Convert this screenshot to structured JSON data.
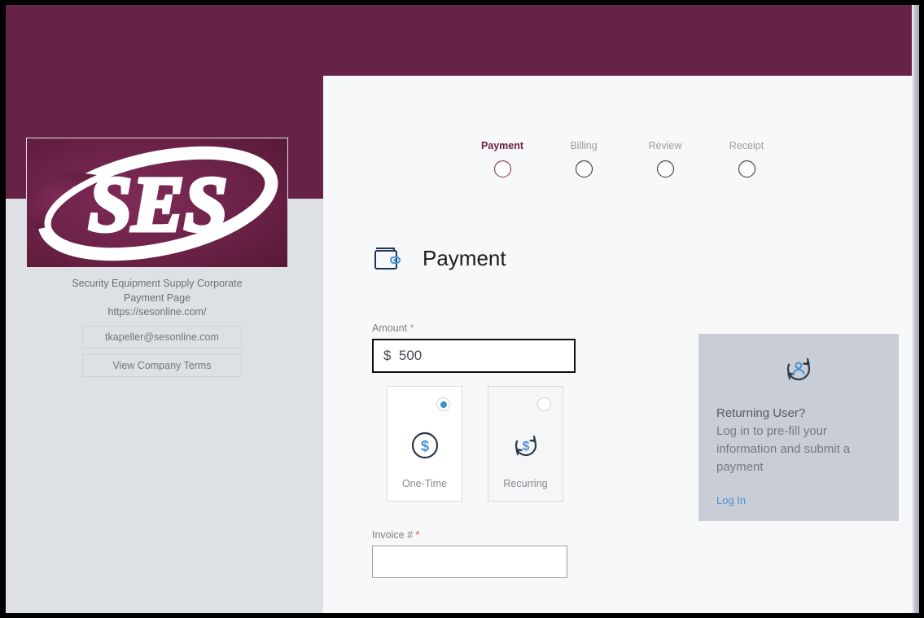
{
  "sidebar": {
    "logo_text": "SES",
    "description_line1": "Security Equipment Supply Corporate",
    "description_line2": "Payment Page",
    "url": "https://sesonline.com/",
    "email_button": "tkapeller@sesonline.com",
    "terms_button": "View Company Terms"
  },
  "stepper": {
    "steps": [
      {
        "label": "Payment",
        "state": "active"
      },
      {
        "label": "Billing",
        "state": "inactive"
      },
      {
        "label": "Review",
        "state": "inactive"
      },
      {
        "label": "Receipt",
        "state": "inactive"
      }
    ],
    "active_color": "#6d2148",
    "inactive_color": "#9a9ca1"
  },
  "main": {
    "heading": "Payment",
    "heading_icon": "wallet-icon",
    "amount": {
      "label": "Amount",
      "required_marker": "*",
      "value": "$  500"
    },
    "payment_type": {
      "options": [
        {
          "label": "One-Time",
          "icon": "dollar-circle-icon",
          "selected": true
        },
        {
          "label": "Recurring",
          "icon": "dollar-recurring-icon",
          "selected": false
        }
      ]
    },
    "invoice": {
      "label": "Invoice #",
      "required_marker": "*",
      "value": "",
      "placeholder": ""
    }
  },
  "returning_user": {
    "icon": "user-recurring-icon",
    "title": "Returning User?",
    "body": "Log in to pre-fill your information and submit a payment",
    "link": "Log In",
    "panel_color": "#c9ced6",
    "link_color": "#4a90d9"
  },
  "theme": {
    "brand_maroon": "#662247",
    "panel_bg": "#f7f8fa",
    "page_bg": "#dde0e5",
    "accent_blue": "#3f8ed0"
  }
}
